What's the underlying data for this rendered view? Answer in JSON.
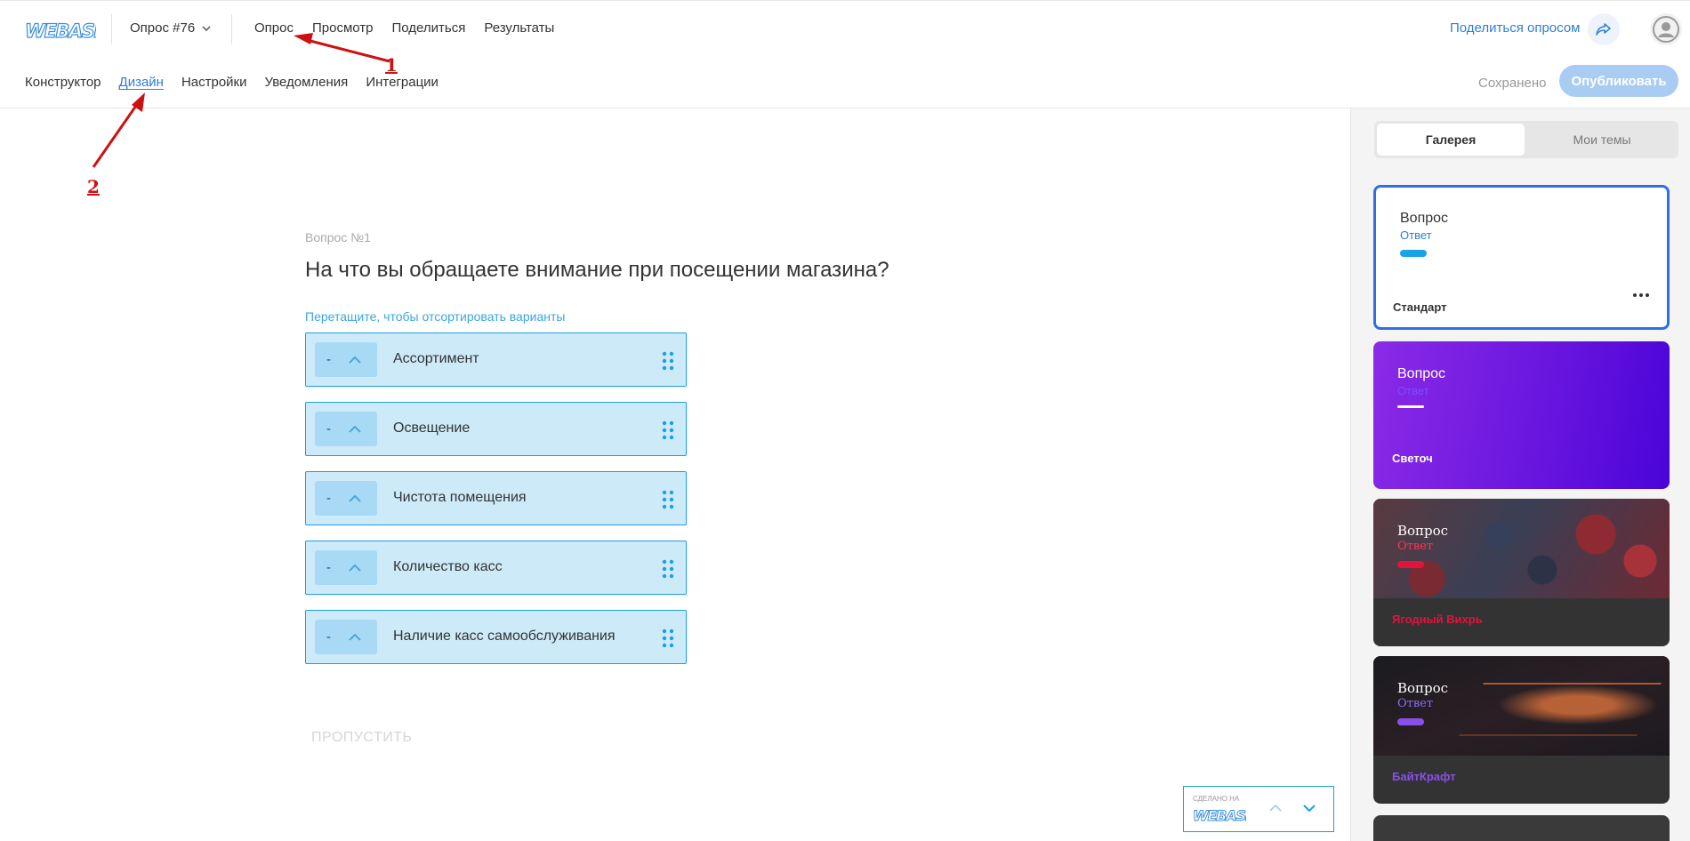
{
  "header": {
    "logo_text": "WEBASK",
    "survey_selector": "Опрос #76",
    "nav": [
      "Опрос",
      "Просмотр",
      "Поделиться",
      "Результаты"
    ],
    "share_link": "Поделиться опросом",
    "icons": [
      "share-icon",
      "user-avatar-icon",
      "chevron-down-icon"
    ]
  },
  "subheader": {
    "tabs": [
      "Конструктор",
      "Дизайн",
      "Настройки",
      "Уведомления",
      "Интеграции"
    ],
    "active_tab": "Дизайн",
    "status": "Сохранено",
    "publish_label": "Опубликовать"
  },
  "annotations": {
    "label_1": "1",
    "label_2": "2",
    "color": "#cc1111"
  },
  "question": {
    "number": "Вопрос №1",
    "title": "На что вы обращаете внимание при посещении магазина?",
    "hint": "Перетащите, чтобы отсортировать варианты",
    "options": [
      {
        "minus": "-",
        "label": "Ассортимент"
      },
      {
        "minus": "-",
        "label": "Освещение"
      },
      {
        "minus": "-",
        "label": "Чистота помещения"
      },
      {
        "minus": "-",
        "label": "Количество касс"
      },
      {
        "minus": "-",
        "label": "Наличие касс самообслуживания"
      }
    ],
    "skip_label": "ПРОПУСТИТЬ"
  },
  "footer_badge": {
    "made_on": "СДЕЛАНО НА",
    "logo_text": "WEBASK"
  },
  "panel": {
    "tabs": [
      "Галерея",
      "Мои темы"
    ],
    "active_tab": "Галерея",
    "themes": [
      {
        "question": "Вопрос",
        "answer": "Ответ",
        "name": "Стандарт",
        "accent": "#1aa3e6"
      },
      {
        "question": "Вопрос",
        "answer": "Ответ",
        "name": "Светоч",
        "accent": "#ffffff"
      },
      {
        "question": "Вопрос",
        "answer": "Ответ",
        "name": "Ягодный Вихрь",
        "accent": "#e0143c"
      },
      {
        "question": "Вопрос",
        "answer": "Ответ",
        "name": "БайтКрафт",
        "accent": "#8a4fe8"
      }
    ]
  }
}
